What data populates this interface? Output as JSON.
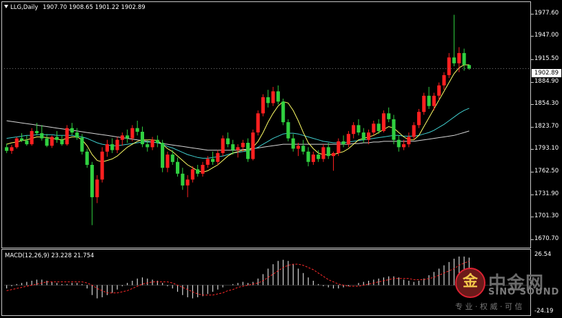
{
  "header": {
    "symbol": "LLG,Daily",
    "ohlc": "1907.70 1908.65 1901.22 1902.89"
  },
  "current_price": "1902.89",
  "price_axis": [
    "1977.60",
    "1947.00",
    "1915.50",
    "1884.90",
    "1854.30",
    "1823.70",
    "1793.10",
    "1762.50",
    "1731.90",
    "1701.30",
    "1670.70"
  ],
  "macd": {
    "label": "MACD(12,26,9) 23.228 21.754",
    "axis_top": "26.54",
    "axis_bottom": "-24.19"
  },
  "watermark": {
    "cn": "中金网",
    "en": "SINO SOUND",
    "sub": "专 业 · 权 威 · 可 信"
  },
  "colors": {
    "up": "#ff2020",
    "down": "#30d040",
    "background": "#000000",
    "ma_fast": "#ffff66",
    "macd_signal": "#ff2a2a",
    "macd_hist": "#d8d8d8"
  },
  "chart_data": {
    "type": "candlestick",
    "ylim": [
      1666,
      1983
    ],
    "bars": [
      [
        1796,
        1801,
        1788,
        1791
      ],
      [
        1791,
        1799,
        1787,
        1796
      ],
      [
        1796,
        1810,
        1794,
        1808
      ],
      [
        1808,
        1815,
        1803,
        1805
      ],
      [
        1805,
        1812,
        1798,
        1800
      ],
      [
        1800,
        1822,
        1798,
        1818
      ],
      [
        1818,
        1829,
        1812,
        1815
      ],
      [
        1815,
        1826,
        1805,
        1808
      ],
      [
        1808,
        1814,
        1796,
        1798
      ],
      [
        1798,
        1812,
        1795,
        1810
      ],
      [
        1810,
        1818,
        1802,
        1806
      ],
      [
        1806,
        1812,
        1798,
        1800
      ],
      [
        1800,
        1826,
        1798,
        1822
      ],
      [
        1822,
        1829,
        1812,
        1816
      ],
      [
        1816,
        1822,
        1806,
        1809
      ],
      [
        1809,
        1814,
        1786,
        1790
      ],
      [
        1790,
        1794,
        1768,
        1772
      ],
      [
        1772,
        1776,
        1690,
        1728
      ],
      [
        1728,
        1758,
        1720,
        1752
      ],
      [
        1752,
        1796,
        1748,
        1790
      ],
      [
        1790,
        1806,
        1783,
        1800
      ],
      [
        1800,
        1808,
        1788,
        1792
      ],
      [
        1792,
        1810,
        1788,
        1806
      ],
      [
        1806,
        1816,
        1798,
        1812
      ],
      [
        1812,
        1820,
        1802,
        1808
      ],
      [
        1808,
        1826,
        1804,
        1822
      ],
      [
        1822,
        1832,
        1812,
        1817
      ],
      [
        1817,
        1824,
        1796,
        1800
      ],
      [
        1800,
        1806,
        1790,
        1796
      ],
      [
        1796,
        1810,
        1792,
        1806
      ],
      [
        1806,
        1812,
        1796,
        1802
      ],
      [
        1802,
        1806,
        1762,
        1768
      ],
      [
        1768,
        1790,
        1762,
        1786
      ],
      [
        1786,
        1792,
        1772,
        1776
      ],
      [
        1776,
        1782,
        1756,
        1760
      ],
      [
        1760,
        1768,
        1738,
        1744
      ],
      [
        1744,
        1758,
        1728,
        1752
      ],
      [
        1752,
        1770,
        1748,
        1766
      ],
      [
        1766,
        1772,
        1756,
        1760
      ],
      [
        1760,
        1776,
        1756,
        1772
      ],
      [
        1772,
        1784,
        1768,
        1780
      ],
      [
        1780,
        1790,
        1772,
        1776
      ],
      [
        1776,
        1792,
        1772,
        1788
      ],
      [
        1788,
        1812,
        1784,
        1808
      ],
      [
        1808,
        1816,
        1796,
        1800
      ],
      [
        1800,
        1806,
        1786,
        1792
      ],
      [
        1792,
        1800,
        1782,
        1796
      ],
      [
        1796,
        1806,
        1790,
        1802
      ],
      [
        1802,
        1808,
        1776,
        1780
      ],
      [
        1780,
        1820,
        1778,
        1816
      ],
      [
        1816,
        1846,
        1812,
        1842
      ],
      [
        1842,
        1868,
        1838,
        1864
      ],
      [
        1864,
        1874,
        1850,
        1856
      ],
      [
        1856,
        1878,
        1852,
        1872
      ],
      [
        1872,
        1880,
        1854,
        1858
      ],
      [
        1858,
        1862,
        1826,
        1830
      ],
      [
        1830,
        1834,
        1804,
        1808
      ],
      [
        1808,
        1814,
        1790,
        1794
      ],
      [
        1794,
        1802,
        1784,
        1798
      ],
      [
        1798,
        1806,
        1786,
        1790
      ],
      [
        1790,
        1796,
        1770,
        1776
      ],
      [
        1776,
        1790,
        1772,
        1786
      ],
      [
        1786,
        1792,
        1776,
        1780
      ],
      [
        1780,
        1800,
        1776,
        1796
      ],
      [
        1796,
        1802,
        1780,
        1784
      ],
      [
        1784,
        1790,
        1764,
        1788
      ],
      [
        1788,
        1808,
        1784,
        1804
      ],
      [
        1804,
        1812,
        1796,
        1800
      ],
      [
        1800,
        1818,
        1796,
        1814
      ],
      [
        1814,
        1830,
        1808,
        1826
      ],
      [
        1826,
        1834,
        1812,
        1816
      ],
      [
        1816,
        1822,
        1802,
        1806
      ],
      [
        1806,
        1820,
        1800,
        1816
      ],
      [
        1816,
        1832,
        1812,
        1828
      ],
      [
        1828,
        1834,
        1814,
        1818
      ],
      [
        1818,
        1846,
        1816,
        1842
      ],
      [
        1842,
        1850,
        1830,
        1834
      ],
      [
        1834,
        1840,
        1800,
        1806
      ],
      [
        1806,
        1812,
        1790,
        1796
      ],
      [
        1796,
        1806,
        1792,
        1800
      ],
      [
        1800,
        1816,
        1796,
        1810
      ],
      [
        1810,
        1830,
        1806,
        1826
      ],
      [
        1826,
        1848,
        1822,
        1844
      ],
      [
        1844,
        1870,
        1840,
        1866
      ],
      [
        1866,
        1878,
        1848,
        1852
      ],
      [
        1852,
        1870,
        1846,
        1866
      ],
      [
        1866,
        1884,
        1860,
        1880
      ],
      [
        1880,
        1898,
        1874,
        1894
      ],
      [
        1894,
        1924,
        1890,
        1918
      ],
      [
        1918,
        1976,
        1906,
        1910
      ],
      [
        1910,
        1932,
        1898,
        1924
      ],
      [
        1924,
        1930,
        1900,
        1908
      ],
      [
        1907.7,
        1908.65,
        1901.22,
        1902.89
      ]
    ],
    "ma_fast": [
      1800,
      1802,
      1803,
      1805,
      1806,
      1808,
      1810,
      1810,
      1809,
      1808,
      1807,
      1806,
      1808,
      1810,
      1810,
      1806,
      1798,
      1786,
      1778,
      1776,
      1778,
      1780,
      1784,
      1790,
      1796,
      1800,
      1804,
      1806,
      1806,
      1806,
      1805,
      1800,
      1794,
      1790,
      1784,
      1778,
      1772,
      1768,
      1764,
      1762,
      1764,
      1768,
      1772,
      1778,
      1784,
      1788,
      1790,
      1792,
      1792,
      1796,
      1804,
      1816,
      1830,
      1842,
      1852,
      1858,
      1856,
      1846,
      1832,
      1816,
      1802,
      1794,
      1788,
      1786,
      1786,
      1786,
      1788,
      1790,
      1794,
      1800,
      1806,
      1808,
      1810,
      1812,
      1816,
      1820,
      1824,
      1822,
      1816,
      1810,
      1806,
      1806,
      1812,
      1824,
      1836,
      1848,
      1860,
      1872,
      1884,
      1896,
      1904,
      1908,
      1908
    ],
    "ma_mid": [
      1808,
      1809,
      1810,
      1811,
      1812,
      1812,
      1813,
      1813,
      1813,
      1813,
      1812,
      1812,
      1812,
      1812,
      1811,
      1810,
      1808,
      1805,
      1802,
      1800,
      1799,
      1798,
      1798,
      1799,
      1800,
      1801,
      1802,
      1803,
      1803,
      1803,
      1802,
      1800,
      1797,
      1795,
      1792,
      1789,
      1786,
      1784,
      1782,
      1781,
      1781,
      1782,
      1783,
      1784,
      1786,
      1788,
      1789,
      1790,
      1791,
      1793,
      1796,
      1800,
      1804,
      1808,
      1811,
      1814,
      1815,
      1815,
      1814,
      1812,
      1810,
      1808,
      1806,
      1804,
      1803,
      1802,
      1802,
      1802,
      1803,
      1804,
      1805,
      1806,
      1807,
      1808,
      1809,
      1810,
      1811,
      1812,
      1812,
      1811,
      1811,
      1811,
      1812,
      1814,
      1816,
      1819,
      1823,
      1827,
      1832,
      1837,
      1842,
      1846,
      1849
    ],
    "ma_slow": [
      1832,
      1831,
      1830,
      1829,
      1828,
      1827,
      1826,
      1825,
      1824,
      1823,
      1822,
      1821,
      1820,
      1819,
      1818,
      1817,
      1816,
      1815,
      1814,
      1813,
      1812,
      1811,
      1810,
      1809,
      1808,
      1807,
      1806,
      1805,
      1804,
      1803,
      1802,
      1801,
      1800,
      1799,
      1798,
      1797,
      1796,
      1795,
      1794,
      1793,
      1792,
      1792,
      1792,
      1792,
      1792,
      1792,
      1792,
      1793,
      1793,
      1794,
      1795,
      1796,
      1797,
      1798,
      1799,
      1800,
      1800,
      1800,
      1800,
      1800,
      1800,
      1800,
      1800,
      1800,
      1800,
      1800,
      1800,
      1800,
      1800,
      1801,
      1801,
      1802,
      1802,
      1803,
      1803,
      1804,
      1804,
      1804,
      1804,
      1804,
      1804,
      1804,
      1805,
      1806,
      1807,
      1808,
      1809,
      1810,
      1811,
      1812,
      1814,
      1816,
      1818
    ],
    "macd_hist": [
      -3,
      -1,
      1,
      2,
      3,
      4,
      5,
      5,
      4,
      3,
      2,
      1,
      1,
      2,
      2,
      1,
      -3,
      -9,
      -12,
      -11,
      -9,
      -7,
      -4,
      -1,
      2,
      4,
      6,
      7,
      6,
      5,
      4,
      2,
      -1,
      -3,
      -6,
      -9,
      -11,
      -12,
      -11,
      -10,
      -8,
      -6,
      -4,
      -2,
      0,
      1,
      2,
      3,
      2,
      3,
      6,
      10,
      15,
      19,
      22,
      23,
      22,
      19,
      15,
      11,
      7,
      4,
      1,
      -1,
      -2,
      -3,
      -3,
      -2,
      -1,
      0,
      2,
      3,
      4,
      5,
      6,
      7,
      8,
      8,
      7,
      5,
      4,
      3,
      4,
      6,
      9,
      12,
      15,
      18,
      21,
      24,
      26,
      26,
      25
    ],
    "macd_signal": [
      -5,
      -4,
      -3,
      -2,
      -1,
      0,
      1,
      2,
      3,
      3,
      3,
      3,
      3,
      3,
      3,
      3,
      2,
      0,
      -3,
      -5,
      -7,
      -7,
      -7,
      -6,
      -5,
      -3,
      -1,
      1,
      2,
      3,
      3,
      3,
      3,
      2,
      0,
      -2,
      -4,
      -6,
      -8,
      -9,
      -9,
      -9,
      -8,
      -7,
      -5,
      -4,
      -2,
      -1,
      0,
      1,
      2,
      4,
      7,
      10,
      13,
      16,
      18,
      19,
      19,
      18,
      16,
      14,
      11,
      8,
      5,
      3,
      1,
      0,
      -1,
      -1,
      -1,
      0,
      1,
      2,
      3,
      4,
      5,
      6,
      6,
      6,
      6,
      5,
      5,
      5,
      6,
      7,
      9,
      11,
      13,
      15,
      18,
      20,
      21.754
    ]
  }
}
